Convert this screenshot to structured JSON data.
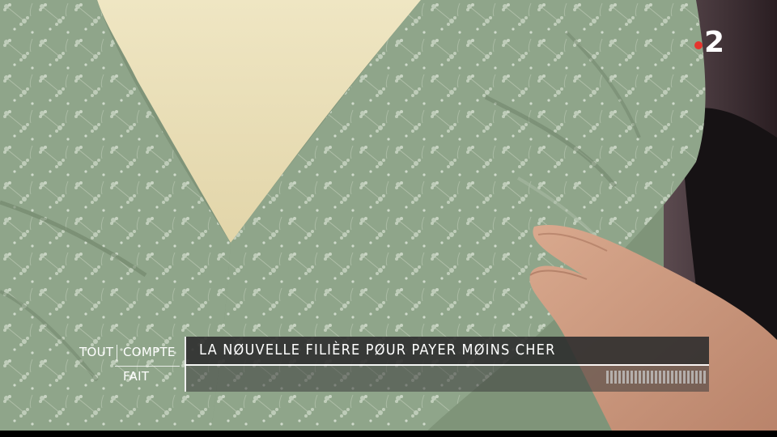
{
  "broadcast": {
    "channel_logo_text": "2",
    "channel_logo_dot_color": "#e5352e",
    "show_name": {
      "word1": "TOUT",
      "word2": "COMPTE",
      "word3": "FAIT"
    },
    "headline": "LA NØUVELLE FILIÈRE PØUR PAYER MØINS CHER"
  },
  "scene": {
    "dress_color": "#8fa58a",
    "mannequin_color": "#e6dcb6"
  }
}
